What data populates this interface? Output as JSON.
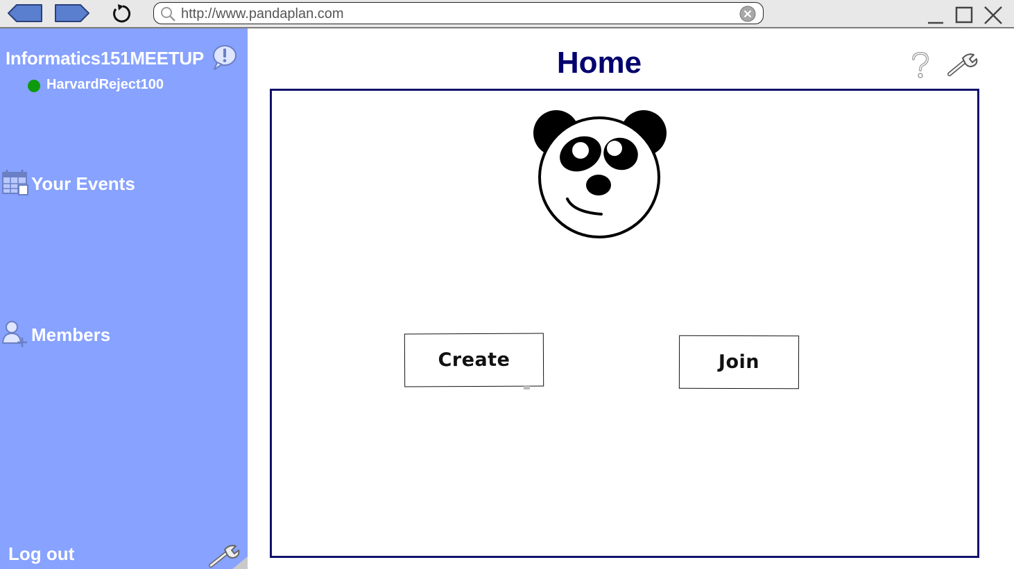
{
  "browser": {
    "url": "http://www.pandaplan.com"
  },
  "sidebar": {
    "group_name": "Informatics151MEETUP",
    "username": "HarvardReject100",
    "status_color": "#0d9a0d",
    "items": [
      {
        "label": "Your Events",
        "icon": "calendar-icon"
      },
      {
        "label": "Members",
        "icon": "add-user-icon"
      }
    ],
    "logout_label": "Log out",
    "background_color": "#87a2ff"
  },
  "main": {
    "title": "Home",
    "title_color": "#00006e",
    "buttons": {
      "create_label": "Create",
      "join_label": "Join"
    }
  }
}
